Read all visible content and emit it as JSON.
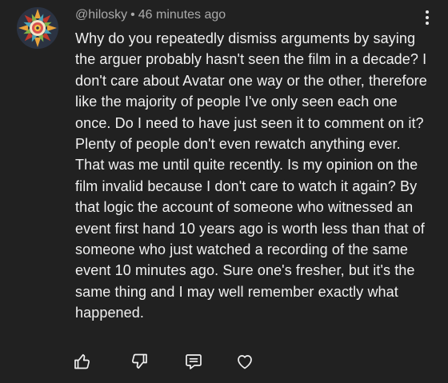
{
  "comment": {
    "author": "@hilosky",
    "separator": "•",
    "timestamp": "46 minutes ago",
    "text": "Why do you repeatedly dismiss arguments by saying the arguer probably hasn't seen the film in a decade? I don't care about Avatar one way or the other, therefore like the majority of people I've only seen each one once. Do I need to have just seen it to comment on it? Plenty of people don't even rewatch anything ever. That was me until quite recently. Is my opinion on the film invalid because I don't care to watch it again? By that logic the account of someone who witnessed an event first hand 10 years ago is worth less than that of someone who just watched a recording of the same event 10 minutes ago. Sure one's fresher, but it's the same thing and I may well remember exactly what happened.",
    "avatar_icon": "mandala-avatar-icon"
  },
  "actions": [
    {
      "name": "like-button",
      "icon": "thumbs-up-icon"
    },
    {
      "name": "dislike-button",
      "icon": "thumbs-down-icon"
    },
    {
      "name": "reply-button",
      "icon": "comment-icon"
    },
    {
      "name": "heart-button",
      "icon": "heart-icon"
    }
  ],
  "menu_icon": "more-vertical-icon",
  "colors": {
    "background": "#212121",
    "text": "#f1f1f1",
    "meta": "#aaaaaa"
  }
}
